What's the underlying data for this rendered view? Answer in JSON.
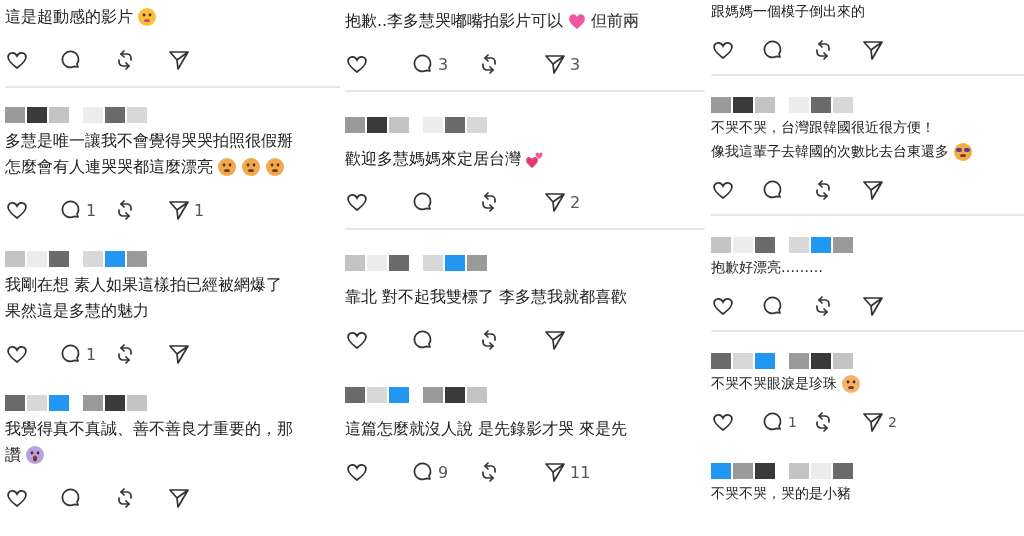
{
  "columns": [
    {
      "posts": [
        {
          "lines": [
            [
              {
                "kind": "text",
                "text": "這是超動感的影片"
              },
              {
                "kind": "tears-emoji"
              }
            ]
          ]
        },
        {
          "lines": [
            [
              {
                "kind": "text",
                "text": "多慧是唯一讓我不會覺得哭哭拍照很假掰"
              }
            ],
            [
              {
                "kind": "text",
                "text": "怎麼會有人連哭哭都這麼漂亮"
              },
              {
                "kind": "drool-emoji"
              },
              {
                "kind": "drool-emoji"
              },
              {
                "kind": "drool-emoji"
              }
            ]
          ],
          "comments": "1",
          "shares": "1"
        },
        {
          "lines": [
            [
              {
                "kind": "text",
                "text": "我剛在想 素人如果這樣拍已經被網爆了"
              }
            ],
            [
              {
                "kind": "text",
                "text": "果然這是多慧的魅力"
              }
            ]
          ],
          "comments": "1"
        },
        {
          "lines": [
            [
              {
                "kind": "text",
                "text": "我覺得真不真誠、善不善良才重要的，那"
              }
            ],
            [
              {
                "kind": "text",
                "text": "讚"
              },
              {
                "kind": "scream-emoji"
              }
            ]
          ]
        }
      ]
    },
    {
      "posts": [
        {
          "lines": [
            [
              {
                "kind": "text",
                "text": "抱歉..李多慧哭嘟嘴拍影片可以"
              },
              {
                "kind": "heart-emoji"
              },
              {
                "kind": "text",
                "text": "但前兩"
              }
            ]
          ],
          "comments": "3",
          "shares": "3"
        },
        {
          "lines": [
            [
              {
                "kind": "text",
                "text": "歡迎多慧媽媽來定居台灣"
              },
              {
                "kind": "hearts-emoji"
              }
            ]
          ],
          "shares": "2"
        },
        {
          "lines": [
            [
              {
                "kind": "text",
                "text": "靠北 對不起我雙標了 李多慧我就都喜歡"
              }
            ]
          ]
        },
        {
          "lines": [
            [
              {
                "kind": "text",
                "text": "這篇怎麼就沒人說 是先錄影才哭 來是先"
              }
            ]
          ],
          "comments": "9",
          "shares": "11"
        }
      ]
    },
    {
      "posts": [
        {
          "lines": [
            [
              {
                "kind": "text",
                "text": "跟媽媽一個模子倒出來的"
              }
            ]
          ]
        },
        {
          "lines": [
            [
              {
                "kind": "text",
                "text": "不哭不哭，台灣跟韓國很近很方便！"
              }
            ],
            [
              {
                "kind": "text",
                "text": "像我這輩子去韓國的次數比去台東還多"
              },
              {
                "kind": "sunglasses-emoji"
              }
            ]
          ]
        },
        {
          "lines": [
            [
              {
                "kind": "text",
                "text": "抱歉好漂亮………"
              }
            ]
          ]
        },
        {
          "lines": [
            [
              {
                "kind": "text",
                "text": "不哭不哭眼淚是珍珠"
              },
              {
                "kind": "pleading-emoji"
              }
            ]
          ],
          "comments": "1",
          "shares": "2"
        },
        {
          "lines": [
            [
              {
                "kind": "text",
                "text": "不哭不哭，哭的是小豬"
              }
            ]
          ]
        }
      ]
    }
  ]
}
